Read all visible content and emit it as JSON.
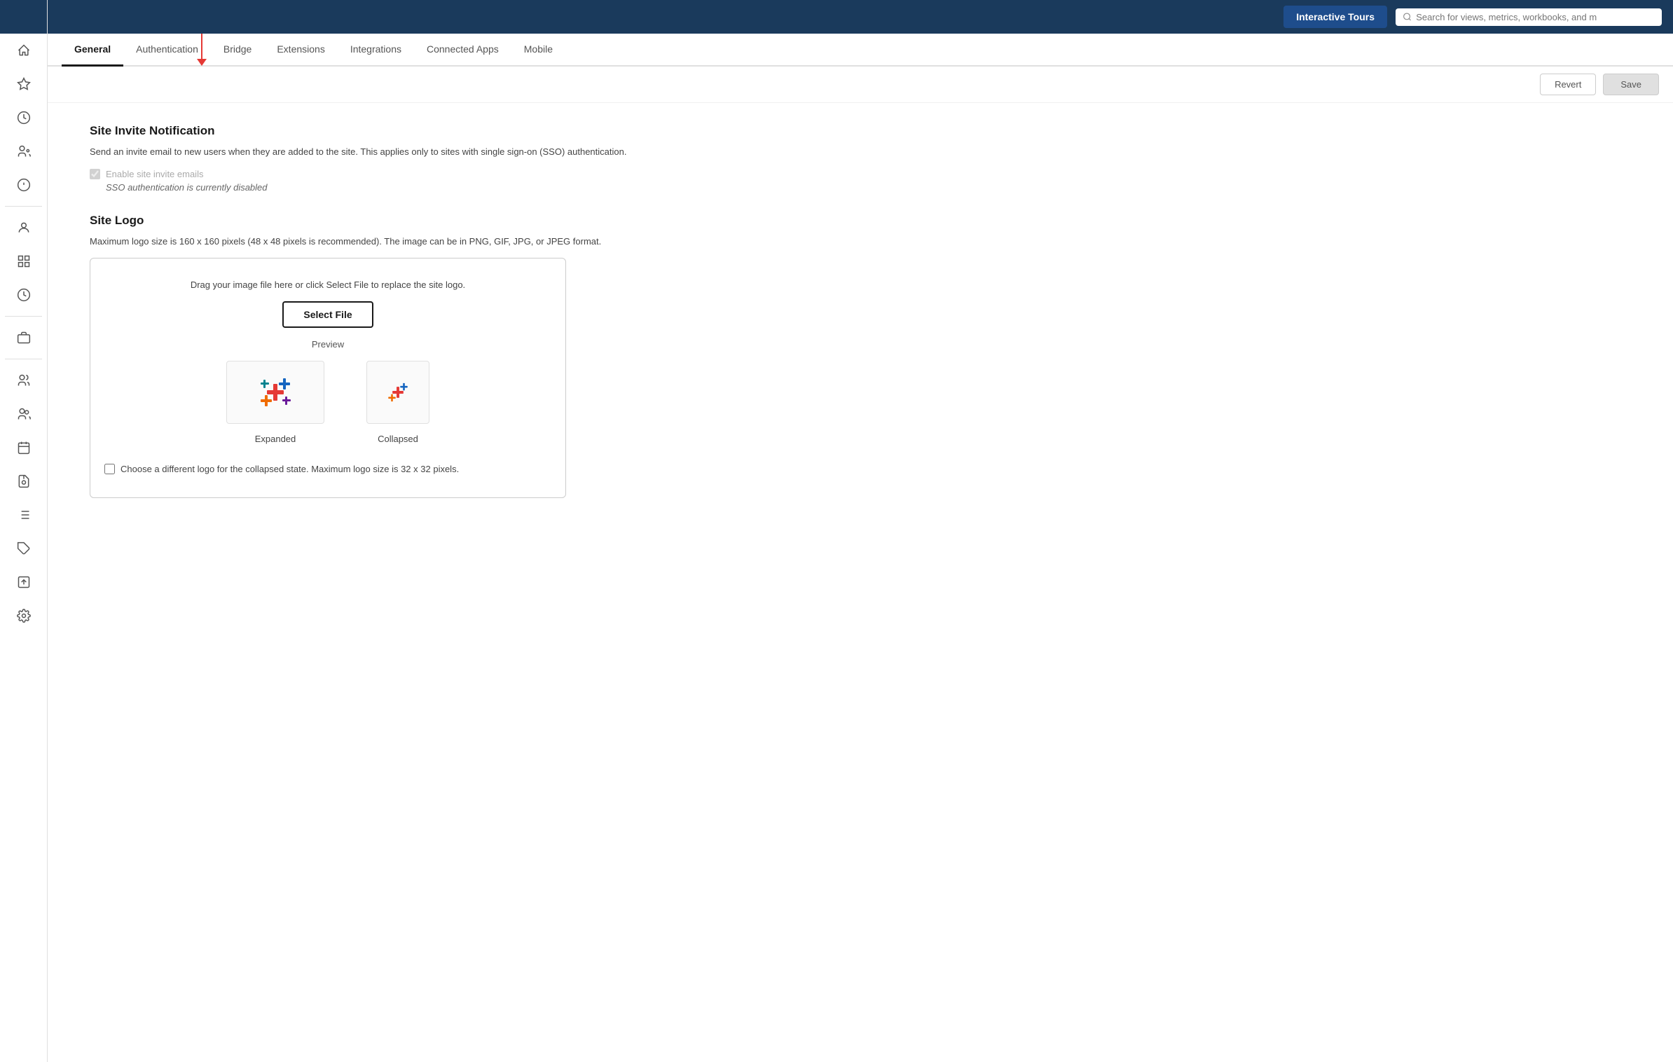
{
  "topbar": {
    "interactive_tours_label": "Interactive Tours",
    "search_placeholder": "Search for views, metrics, workbooks, and m"
  },
  "tabs": {
    "items": [
      {
        "id": "general",
        "label": "General",
        "active": true
      },
      {
        "id": "authentication",
        "label": "Authentication",
        "active": false
      },
      {
        "id": "bridge",
        "label": "Bridge",
        "active": false
      },
      {
        "id": "extensions",
        "label": "Extensions",
        "active": false
      },
      {
        "id": "integrations",
        "label": "Integrations",
        "active": false
      },
      {
        "id": "connected-apps",
        "label": "Connected Apps",
        "active": false
      },
      {
        "id": "mobile",
        "label": "Mobile",
        "active": false
      }
    ]
  },
  "action_bar": {
    "revert_label": "Revert",
    "save_label": "Save"
  },
  "site_invite": {
    "title": "Site Invite Notification",
    "description": "Send an invite email to new users when they are added to the site. This applies only to sites with single sign-on (SSO) authentication.",
    "checkbox_label": "Enable site invite emails",
    "sso_note": "SSO authentication is currently disabled"
  },
  "site_logo": {
    "title": "Site Logo",
    "description": "Maximum logo size is 160 x 160 pixels (48 x 48 pixels is recommended). The image can be in PNG, GIF, JPG, or JPEG format.",
    "drag_text": "Drag your image file here or click Select File to replace the site logo.",
    "select_file_label": "Select File",
    "preview_label": "Preview",
    "expanded_label": "Expanded",
    "collapsed_label": "Collapsed",
    "collapsed_checkbox_text": "Choose a different logo for the collapsed state. Maximum logo size is 32 x 32 pixels."
  },
  "sidebar": {
    "icons": [
      {
        "name": "home-icon",
        "symbol": "⌂"
      },
      {
        "name": "star-icon",
        "symbol": "☆"
      },
      {
        "name": "clock-icon",
        "symbol": "⏱"
      },
      {
        "name": "users-icon",
        "symbol": "👥"
      },
      {
        "name": "bulb-icon",
        "symbol": "💡"
      },
      {
        "name": "person-icon",
        "symbol": "👤"
      },
      {
        "name": "grid-icon",
        "symbol": "⊞"
      },
      {
        "name": "clock2-icon",
        "symbol": "⏰"
      },
      {
        "name": "inbox-icon",
        "symbol": "📥"
      },
      {
        "name": "people-icon",
        "symbol": "👥"
      },
      {
        "name": "group-icon",
        "symbol": "👫"
      },
      {
        "name": "calendar-icon",
        "symbol": "📅"
      },
      {
        "name": "file-clock-icon",
        "symbol": "📋"
      },
      {
        "name": "list-icon",
        "symbol": "☰"
      },
      {
        "name": "tag-icon",
        "symbol": "🏷"
      },
      {
        "name": "schedule-icon",
        "symbol": "📊"
      },
      {
        "name": "gear-icon",
        "symbol": "⚙"
      }
    ]
  }
}
